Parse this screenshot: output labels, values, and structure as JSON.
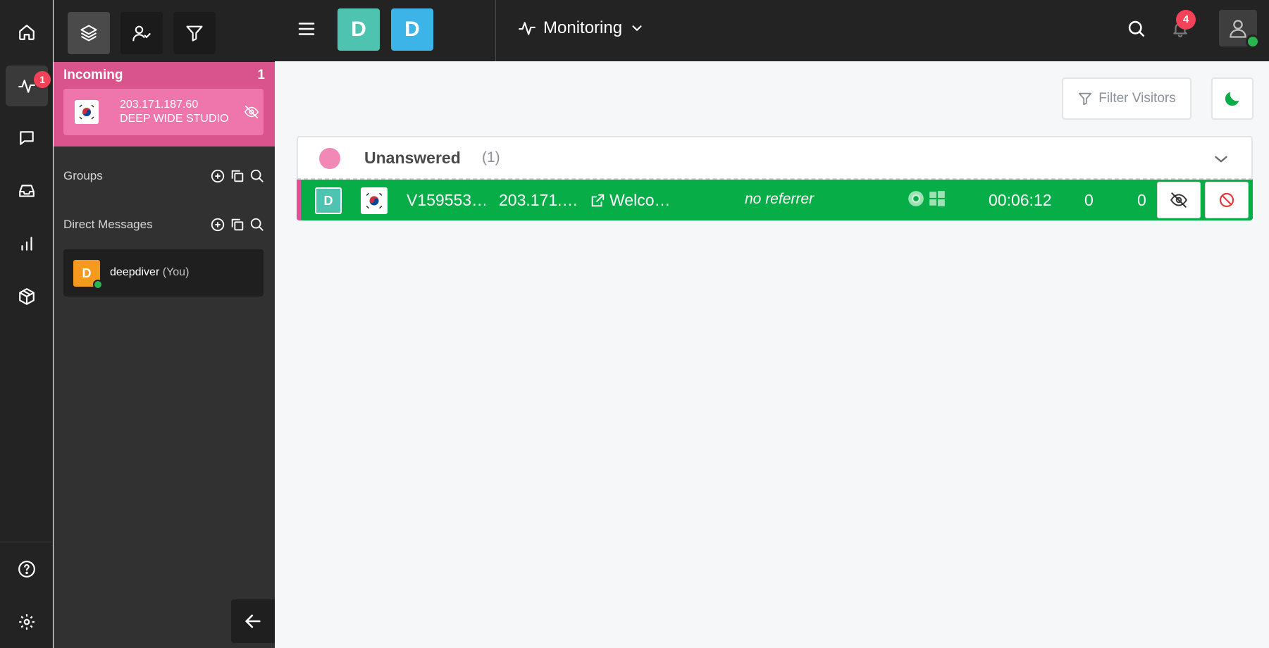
{
  "rail": {
    "items": [
      {
        "icon": "home-icon"
      },
      {
        "icon": "activity-icon",
        "badge": "1"
      },
      {
        "icon": "chat-icon"
      },
      {
        "icon": "inbox-icon"
      },
      {
        "icon": "stats-icon"
      },
      {
        "icon": "package-icon"
      }
    ],
    "bottom": [
      {
        "icon": "help-icon"
      },
      {
        "icon": "settings-icon"
      }
    ]
  },
  "sidebar": {
    "tools": [
      {
        "icon": "layers-icon"
      },
      {
        "icon": "user-check-icon"
      },
      {
        "icon": "filter-icon"
      }
    ],
    "incoming": {
      "title": "Incoming",
      "count": "1",
      "visitor": {
        "ip": "203.171.187.60",
        "company": "DEEP WIDE STUDIO",
        "flag": "south-korea-flag"
      }
    },
    "groups_label": "Groups",
    "dm_label": "Direct Messages",
    "dm_items": [
      {
        "initial": "D",
        "name": "deepdiver",
        "suffix": "(You)"
      }
    ]
  },
  "topbar": {
    "workspaces": [
      {
        "initial": "D",
        "color": "#4ec3b0"
      },
      {
        "initial": "D",
        "color": "#3cb4e8"
      }
    ],
    "section": "Monitoring",
    "notification_count": "4"
  },
  "main": {
    "filter_label": "Filter Visitors",
    "panel": {
      "title": "Unanswered",
      "count": "(1)",
      "status_color": "#f288b5"
    },
    "visitor": {
      "initial": "D",
      "id": "V159553…",
      "ip": "203.171.…",
      "page": "Welco…",
      "referrer": "no referrer",
      "duration": "00:06:12",
      "stat1": "0",
      "stat2": "0"
    }
  },
  "colors": {
    "accent_pink": "#d9538d",
    "row_green": "#07ad47",
    "badge_red": "#f44358",
    "online_green": "#2bb550"
  }
}
